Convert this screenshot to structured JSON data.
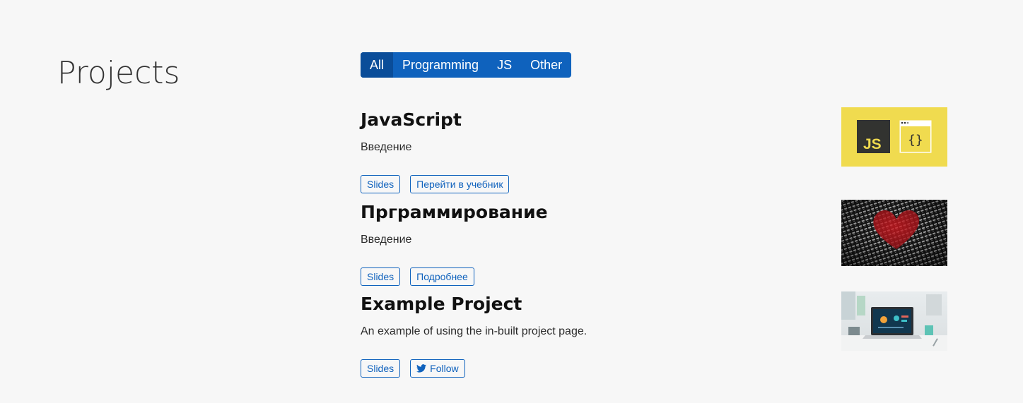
{
  "section": {
    "title": "Projects"
  },
  "filters": [
    {
      "label": "All",
      "active": true
    },
    {
      "label": "Programming",
      "active": false
    },
    {
      "label": "JS",
      "active": false
    },
    {
      "label": "Other",
      "active": false
    }
  ],
  "projects": [
    {
      "title": "JavaScript",
      "summary": "Введение",
      "links": [
        {
          "label": "Slides"
        },
        {
          "label": "Перейти в учебник"
        }
      ],
      "thumbnail": "javascript-logo-image"
    },
    {
      "title": "Прграммирование",
      "summary": "Введение",
      "links": [
        {
          "label": "Slides"
        },
        {
          "label": "Подробнее"
        }
      ],
      "thumbnail": "binary-heart-image"
    },
    {
      "title": "Example Project",
      "summary": "An example of using the in-built project page.",
      "links": [
        {
          "label": "Slides"
        },
        {
          "label": "Follow",
          "icon": "twitter-icon"
        }
      ],
      "thumbnail": "laptop-desk-image"
    }
  ],
  "colors": {
    "accent": "#0f62bd",
    "accent_active": "#0a4d99",
    "background": "#f7f7f7",
    "js_yellow": "#f0db4f"
  }
}
